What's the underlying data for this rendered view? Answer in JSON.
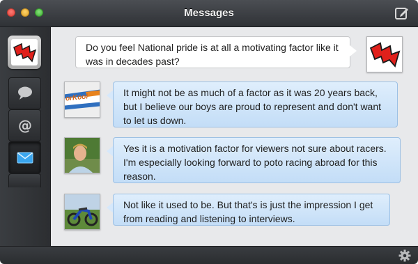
{
  "window": {
    "title": "Messages"
  },
  "sidebar": {
    "account": "red-lightning-logo",
    "items": [
      {
        "name": "chat",
        "icon": "speech-bubble-icon"
      },
      {
        "name": "mentions",
        "icon": "at-sign-icon"
      },
      {
        "name": "messages",
        "icon": "envelope-icon",
        "active": true
      }
    ]
  },
  "messages": [
    {
      "from": "me",
      "text": "Do you feel National pride is at all a motivating factor like it was in decades past?"
    },
    {
      "from": "user1",
      "text": "It might not be as much of a factor as it was 20 years back, but I believe our boys are proud to represent and don't want to let us down."
    },
    {
      "from": "user2",
      "text": "Yes it is a motivation factor for viewers not sure about racers. I'm especially looking forward to poto racing abroad for this reason."
    },
    {
      "from": "user3",
      "text": "Not like it used to be. But that's is just the impression I get from reading and listening to interviews."
    }
  ],
  "avatars": {
    "user1_banner_text": "orKool"
  },
  "colors": {
    "accent": "#e0201b",
    "bubble_blue": "#c3ddf7",
    "chrome_dark": "#2f3236"
  }
}
